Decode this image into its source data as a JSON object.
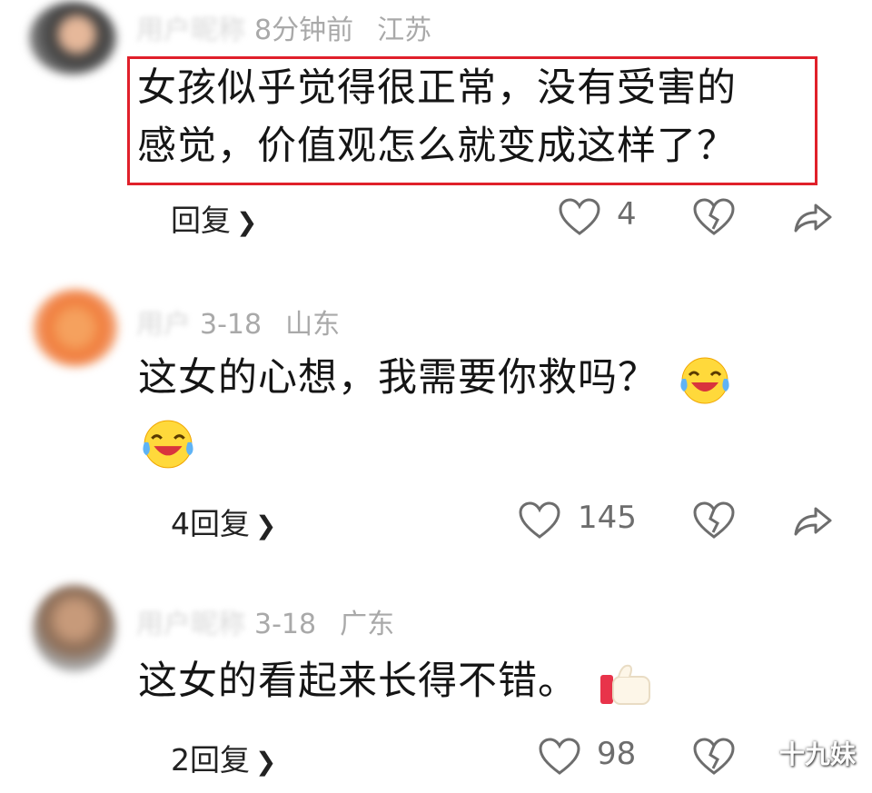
{
  "comments": [
    {
      "name": "用户昵称",
      "time": "8分钟前",
      "location": "江苏",
      "lines": [
        "女孩似乎觉得很正常，没有受害的",
        "感觉，价值观怎么就变成这样了？"
      ],
      "reply_label": "回复",
      "like_count": "4",
      "avatar_color": "#3b3b3b"
    },
    {
      "name": "用户",
      "time": "3-18",
      "location": "山东",
      "lines": [
        "这女的心想，我需要你救吗？"
      ],
      "emojis": [
        "laughing-crying-emoji",
        "laughing-crying-emoji"
      ],
      "reply_label": "4回复",
      "like_count": "145",
      "avatar_color": "#f07a3a"
    },
    {
      "name": "用户昵称",
      "time": "3-18",
      "location": "广东",
      "lines": [
        "这女的看起来长得不错。"
      ],
      "emojis": [
        "thumbs-up-emoji"
      ],
      "reply_label": "2回复",
      "like_count": "98",
      "avatar_color": "#8a6b55"
    }
  ],
  "icons": {
    "reply_chevron": "chevron-right-icon",
    "like": "heart-outline-icon",
    "dislike": "broken-heart-icon",
    "share": "share-arrow-icon"
  },
  "colors": {
    "highlight_border": "#e0202a",
    "meta_text": "#a9a9a9",
    "icon_stroke": "#6d6d6d"
  },
  "watermark": "十九妹"
}
